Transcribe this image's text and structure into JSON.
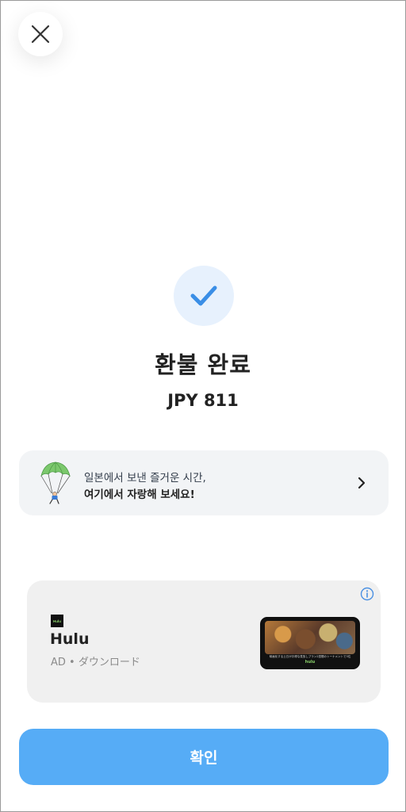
{
  "header": {
    "close_icon": "close-icon"
  },
  "status": {
    "icon": "checkmark-icon",
    "title": "환불 완료",
    "amount": "JPY 811"
  },
  "promo": {
    "icon": "parachute-icon",
    "line1": "일본에서 보낸 즐거운 시간,",
    "line2": "여기에서 자랑해 보세요!",
    "chevron": "chevron-right-icon"
  },
  "ad": {
    "info_icon": "info-icon",
    "logo_text": "Hulu",
    "name": "Hulu",
    "meta": "AD • ダウンロード",
    "thumbnail_caption": "映画化する土日がお得な見放しプラン2週間のトーナメントで3位",
    "thumbnail_brand": "hulu"
  },
  "footer": {
    "confirm_label": "확인"
  },
  "colors": {
    "accent": "#56acf6",
    "check": "#3a8ee6",
    "check_bg": "#e7f1fd",
    "promo_bg": "#f2f4f6",
    "ad_bg": "#f0f0f0"
  }
}
